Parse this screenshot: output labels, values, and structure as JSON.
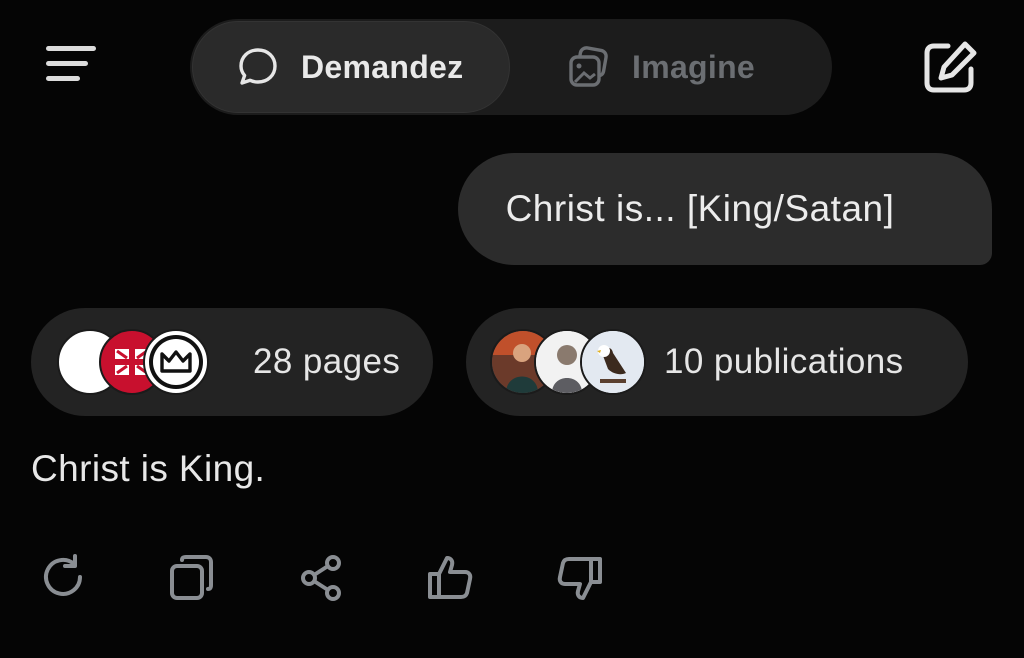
{
  "header": {
    "tabs": [
      {
        "label": "Demandez",
        "icon": "chat-bubble-icon",
        "active": true
      },
      {
        "label": "Imagine",
        "icon": "image-stack-icon",
        "active": false
      }
    ]
  },
  "conversation": {
    "user_message": "Christ is... [King/Satan]",
    "sources": {
      "pages_label": "28 pages",
      "publications_label": "10 publications"
    },
    "answer": "Christ is King."
  },
  "actions": [
    "refresh-icon",
    "copy-icon",
    "share-icon",
    "thumbs-up-icon",
    "thumbs-down-icon"
  ],
  "colors": {
    "background": "#050505",
    "pill": "#232323",
    "bubble": "#2c2c2c",
    "inactive_text": "#6b6e72",
    "icon_gray": "#8a8e93"
  }
}
